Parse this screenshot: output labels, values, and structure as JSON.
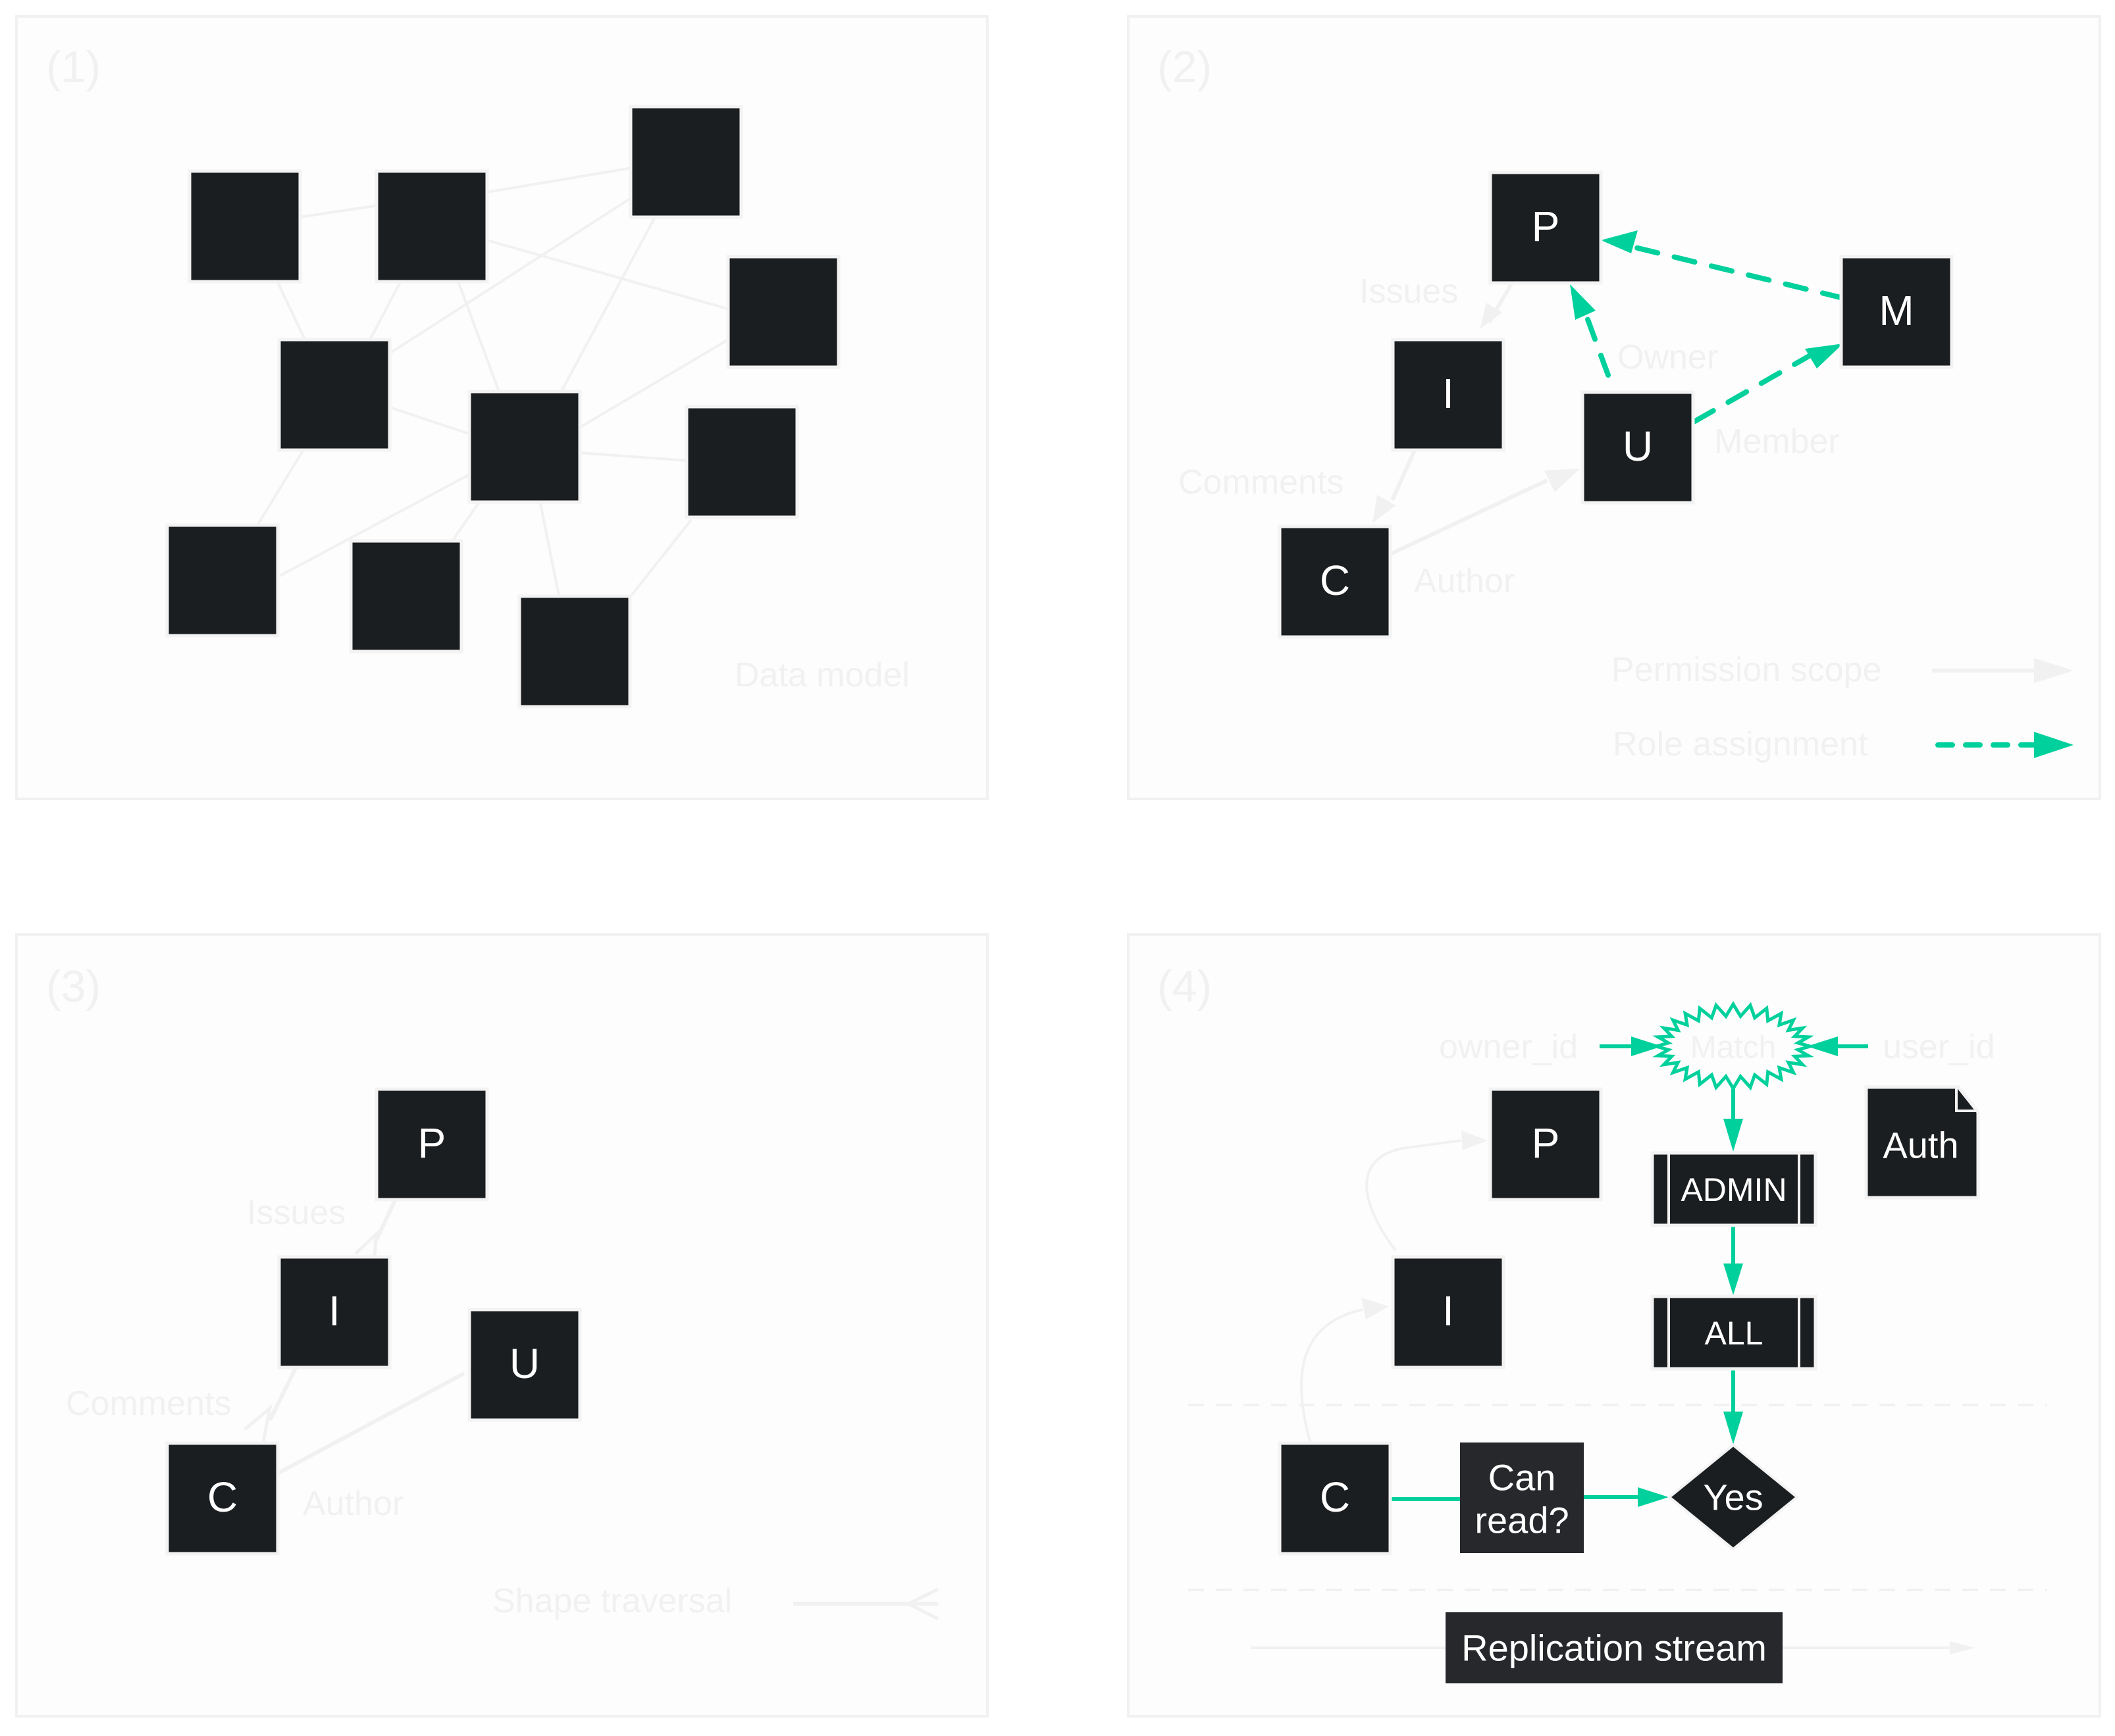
{
  "colors": {
    "accent": "#00D09C",
    "node": "#1B1E20",
    "faint": "#F1F1F1"
  },
  "panel1": {
    "number": "(1)",
    "caption": "Data model",
    "node_count": 10
  },
  "panel2": {
    "number": "(2)",
    "nodes": {
      "p": "P",
      "i": "I",
      "u": "U",
      "c": "C",
      "m": "M"
    },
    "edge_labels": {
      "issues": "Issues",
      "owner": "Owner",
      "member": "Member",
      "comments": "Comments",
      "author": "Author"
    },
    "legend": [
      {
        "label": "Permission scope",
        "style": "solid-gray-arrow"
      },
      {
        "label": "Role assignment",
        "style": "dashed-teal-arrow"
      }
    ]
  },
  "panel3": {
    "number": "(3)",
    "nodes": {
      "p": "P",
      "i": "I",
      "u": "U",
      "c": "C"
    },
    "edge_labels": {
      "issues": "Issues",
      "comments": "Comments",
      "author": "Author"
    },
    "legend": [
      {
        "label": "Shape traversal",
        "style": "crowfoot-line"
      }
    ]
  },
  "panel4": {
    "number": "(4)",
    "nodes": {
      "p": "P",
      "i": "I",
      "c": "C",
      "auth": "Auth"
    },
    "match": {
      "label": "Match",
      "left_input": "owner_id",
      "right_input": "user_id"
    },
    "steps": {
      "admin": "ADMIN",
      "all": "ALL"
    },
    "can_read": [
      "Can",
      "read?"
    ],
    "decision": "Yes",
    "stream": "Replication stream"
  }
}
